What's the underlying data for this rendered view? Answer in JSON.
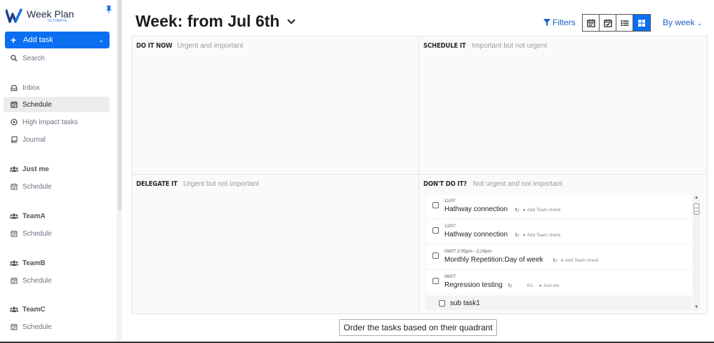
{
  "brand": {
    "name": "Week Plan",
    "edition": "ULTIMATE"
  },
  "sidebar": {
    "add_task_label": "Add task",
    "items": [
      {
        "label": "Search",
        "icon": "search-icon"
      },
      {
        "label": "Inbox",
        "icon": "inbox-icon"
      },
      {
        "label": "Schedule",
        "icon": "calendar-check-icon",
        "active": true
      },
      {
        "label": "High impact tasks",
        "icon": "target-icon"
      },
      {
        "label": "Journal",
        "icon": "book-icon"
      }
    ],
    "sections": [
      {
        "name": "Just me",
        "icon": "users-icon",
        "item": "Schedule"
      },
      {
        "name": "TeamA",
        "icon": "users-icon",
        "item": "Schedule"
      },
      {
        "name": "TeamB",
        "icon": "users-icon",
        "item": "Schedule"
      },
      {
        "name": "TeamC",
        "icon": "users-icon",
        "item": "Schedule"
      }
    ]
  },
  "header": {
    "title": "Week: from Jul 6th",
    "filters_label": "Filters",
    "views": [
      "calendar-icon",
      "calendar-check-icon",
      "list-icon",
      "grid-icon"
    ],
    "active_view": "grid-icon",
    "period_label": "By week"
  },
  "quadrants": {
    "do": {
      "title": "DO IT NOW",
      "subtitle": "Urgent and important"
    },
    "schedule": {
      "title": "SCHEDULE IT",
      "subtitle": "Important but not urgent"
    },
    "delegate": {
      "title": "DELEGATE IT",
      "subtitle": "Urgent but not important"
    },
    "dont": {
      "title": "DON'T DO IT?",
      "subtitle": "Not urgent and not important"
    }
  },
  "dont_tasks": [
    {
      "date": "11/07",
      "title": "Hathway connection",
      "count": "",
      "group": "Add Team check"
    },
    {
      "date": "12/07",
      "title": "Hathway connection",
      "count": "",
      "group": "Add Team check"
    },
    {
      "date": "09/07 2:05pm - 2:20pm",
      "title": "Monthly Repetition:Day of week",
      "count": "",
      "group": "Add Team check"
    },
    {
      "date": "06/07",
      "title": "Regression testing",
      "count": "0/1",
      "group": "Just me"
    }
  ],
  "dont_subtasks": [
    {
      "title": "sub task1"
    }
  ],
  "footer": {
    "order_button_label": "Order the tasks based on their quadrant"
  },
  "colors": {
    "accent": "#0b6ff2",
    "link": "#1a5cc4"
  }
}
